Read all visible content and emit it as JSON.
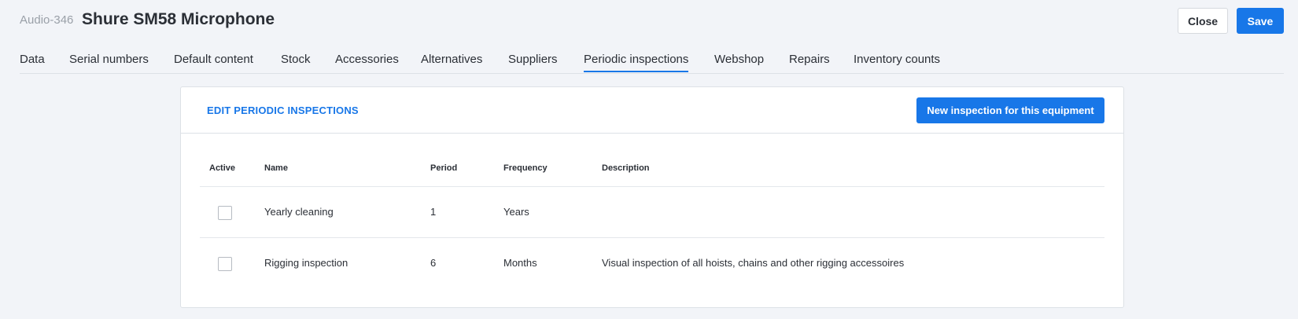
{
  "header": {
    "code": "Audio-346",
    "title": "Shure SM58 Microphone",
    "close_label": "Close",
    "save_label": "Save"
  },
  "tabs": [
    {
      "label": "Data",
      "active": false
    },
    {
      "label": "Serial numbers",
      "active": false
    },
    {
      "label": "Default content",
      "active": false
    },
    {
      "label": "Stock",
      "active": false
    },
    {
      "label": "Accessories",
      "active": false
    },
    {
      "label": "Alternatives",
      "active": false
    },
    {
      "label": "Suppliers",
      "active": false
    },
    {
      "label": "Periodic inspections",
      "active": true
    },
    {
      "label": "Webshop",
      "active": false
    },
    {
      "label": "Repairs",
      "active": false
    },
    {
      "label": "Inventory counts",
      "active": false
    }
  ],
  "panel": {
    "title": "EDIT PERIODIC INSPECTIONS",
    "new_button_label": "New inspection for this equipment"
  },
  "table": {
    "columns": [
      "Active",
      "Name",
      "Period",
      "Frequency",
      "Description"
    ],
    "rows": [
      {
        "active": false,
        "name": "Yearly cleaning",
        "period": "1",
        "frequency": "Years",
        "description": ""
      },
      {
        "active": false,
        "name": "Rigging inspection",
        "period": "6",
        "frequency": "Months",
        "description": "Visual inspection of all hoists, chains and other rigging accessoires"
      }
    ]
  },
  "colors": {
    "accent": "#1877e8",
    "background": "#f2f4f8",
    "text": "#2b2f36",
    "muted": "#9aa0a8"
  }
}
